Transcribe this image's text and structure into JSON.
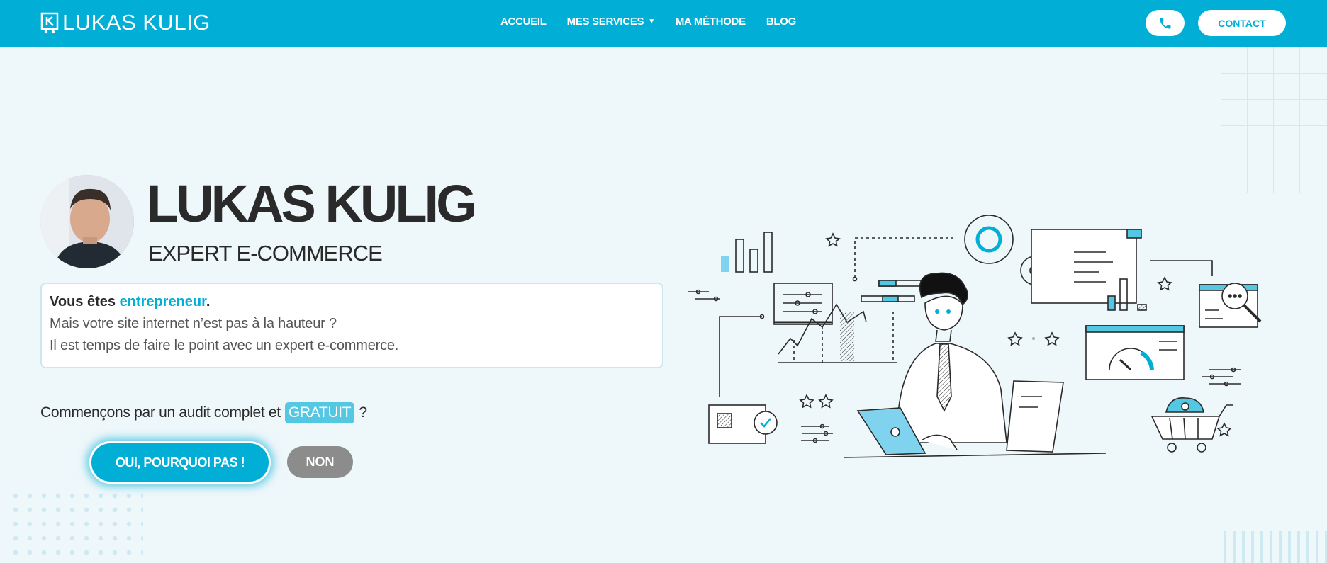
{
  "header": {
    "logo_text": "LUKAS KULIG",
    "nav": [
      {
        "label": "ACCUEIL"
      },
      {
        "label": "MES SERVICES",
        "caret": "▼"
      },
      {
        "label": "MA MÉTHODE"
      },
      {
        "label": "BLOG"
      }
    ],
    "phone_icon": "phone-icon",
    "contact_label": "CONTACT"
  },
  "hero": {
    "name": "LUKAS KULIG",
    "subtitle": "EXPERT E-COMMERCE",
    "intro": {
      "line1_prefix": "Vous êtes ",
      "line1_accent": "entrepreneur",
      "line1_suffix": ".",
      "line2": "Mais votre site internet n’est pas à la hauteur ?",
      "line3": "Il est temps de faire le point avec un expert e-commerce."
    },
    "question_prefix": "Commençons par un audit complet et",
    "question_badge": "GRATUIT",
    "question_suffix": "?",
    "yes_label": "OUI, POURQUOI PAS !",
    "no_label": "NON"
  },
  "colors": {
    "brand": "#00aed6",
    "background": "#eef7fa",
    "accent_light": "#54c8e3",
    "button_grey": "#8c8c8c",
    "text_dark": "#2a2a2a"
  }
}
